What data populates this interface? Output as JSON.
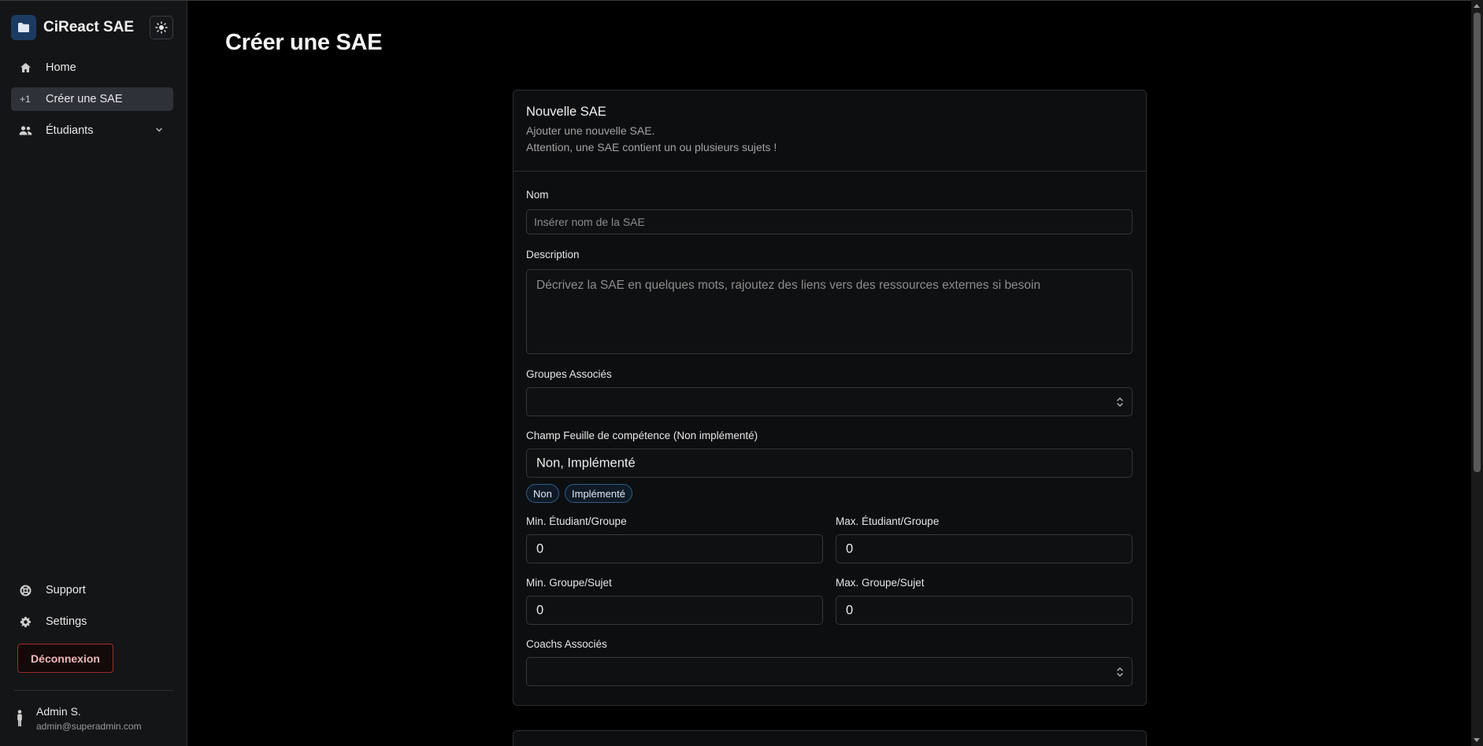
{
  "app": {
    "name": "CiReact SAE"
  },
  "sidebar": {
    "items": [
      {
        "label": "Home",
        "icon": "home-icon"
      },
      {
        "label": "Créer une SAE",
        "icon": "plus-one-icon",
        "icon_text": "+1",
        "active": true
      },
      {
        "label": "Étudiants",
        "icon": "people-icon"
      }
    ],
    "bottom_items": [
      {
        "label": "Support",
        "icon": "lifebuoy-icon"
      },
      {
        "label": "Settings",
        "icon": "gear-icon"
      }
    ],
    "logout_label": "Déconnexion",
    "user": {
      "name": "Admin S.",
      "email": "admin@superadmin.com"
    }
  },
  "page": {
    "title": "Créer une SAE"
  },
  "form": {
    "title": "Nouvelle SAE",
    "description_line1": "Ajouter une nouvelle SAE.",
    "description_line2": "Attention, une SAE contient un ou plusieurs sujets !",
    "nom": {
      "label": "Nom",
      "placeholder": "Insérer nom de la SAE",
      "value": ""
    },
    "description": {
      "label": "Description",
      "placeholder": "Décrivez la SAE en quelques mots, rajoutez des liens vers des ressources externes si besoin",
      "value": ""
    },
    "groupes": {
      "label": "Groupes Associés",
      "value": ""
    },
    "competence": {
      "label": "Champ Feuille de compétence (Non implémenté)",
      "value": "Non, Implémenté",
      "tags": [
        "Non",
        "Implémenté"
      ]
    },
    "min_etudiant": {
      "label": "Min. Étudiant/Groupe",
      "value": "0"
    },
    "max_etudiant": {
      "label": "Max. Étudiant/Groupe",
      "value": "0"
    },
    "min_groupe": {
      "label": "Min. Groupe/Sujet",
      "value": "0"
    },
    "max_groupe": {
      "label": "Max. Groupe/Sujet",
      "value": "0"
    },
    "coachs": {
      "label": "Coachs Associés",
      "value": ""
    }
  },
  "colors": {
    "accent": "#1c3b63",
    "danger": "#9b2c2c",
    "tag_border": "#2d5d8a"
  }
}
